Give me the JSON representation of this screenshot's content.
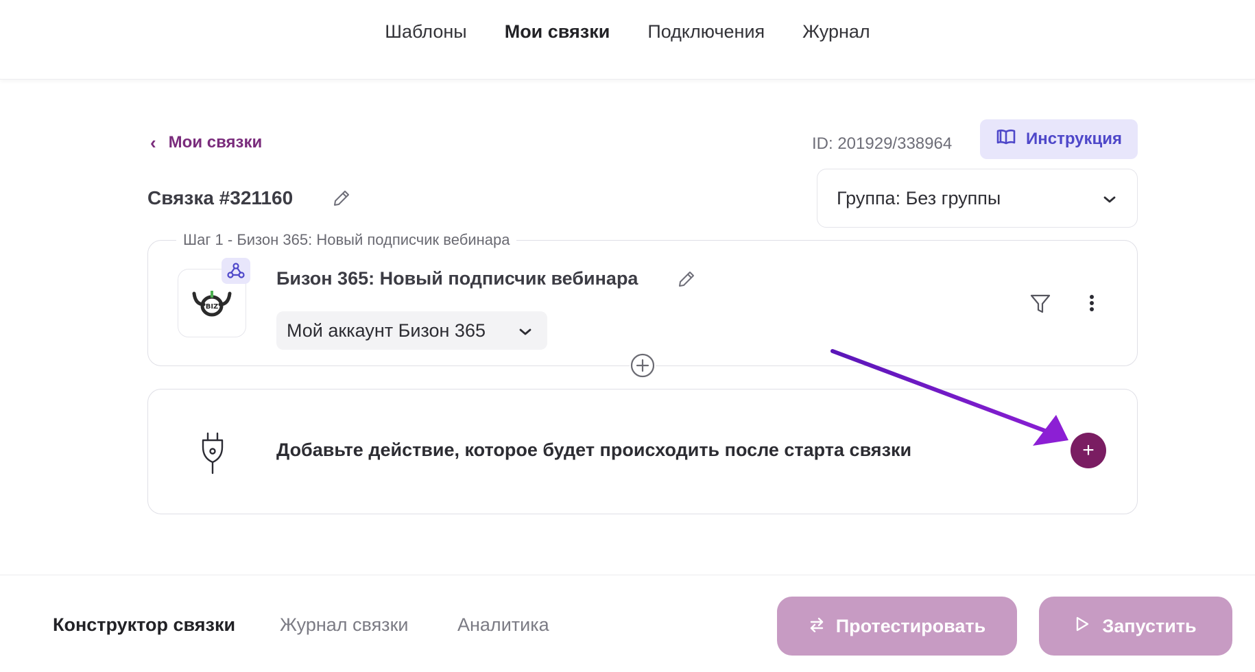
{
  "topnav": {
    "tabs": [
      {
        "label": "Шаблоны",
        "active": false
      },
      {
        "label": "Мои связки",
        "active": true
      },
      {
        "label": "Подключения",
        "active": false
      },
      {
        "label": "Журнал",
        "active": false
      }
    ]
  },
  "header": {
    "back_label": "Мои связки",
    "id_text": "ID: 201929/338964",
    "instruction_label": "Инструкция",
    "title": "Связка #321160",
    "group_select_value": "Группа: Без группы"
  },
  "step": {
    "legend": "Шаг 1 - Бизон 365: Новый подписчик вебинара",
    "title": "Бизон 365: Новый подписчик вебинара",
    "account_value": "Мой аккаунт Бизон 365",
    "logo_text": "BIZ"
  },
  "action": {
    "text": "Добавьте действие, которое будет происходить после старта связки",
    "add_label": "+"
  },
  "bottombar": {
    "tabs": [
      {
        "label": "Конструктор связки",
        "active": true
      },
      {
        "label": "Журнал связки",
        "active": false
      },
      {
        "label": "Аналитика",
        "active": false
      }
    ],
    "test_label": "Протестировать",
    "run_label": "Запустить"
  },
  "colors": {
    "brand_purple": "#7a2c7c",
    "accent_button": "#c79bc3",
    "add_button": "#7a1d62",
    "instruction_bg": "#e8e6fb",
    "instruction_text": "#4e47c9",
    "annotation_arrow": "#7a1fc9"
  },
  "icons": [
    "chevron-left-icon",
    "book-icon",
    "pencil-icon",
    "chevron-down-icon",
    "webhook-icon",
    "bison-logo-icon",
    "filter-icon",
    "more-vertical-icon",
    "plus-circle-icon",
    "plug-icon",
    "swap-icon",
    "play-icon"
  ]
}
